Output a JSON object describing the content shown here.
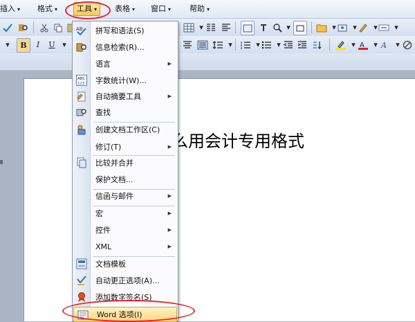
{
  "menubar": {
    "items": [
      {
        "label": "插入",
        "arrow": "▾"
      },
      {
        "label": "格式",
        "arrow": "▾"
      },
      {
        "label": "工具",
        "arrow": "▾"
      },
      {
        "label": "表格",
        "arrow": "▾"
      },
      {
        "label": "窗口",
        "arrow": "▾"
      },
      {
        "label": "帮助",
        "arrow": "▾"
      }
    ]
  },
  "toolbar": {
    "bold": "B",
    "italic": "I",
    "underline": "U"
  },
  "document": {
    "text": "么用会计专用格式"
  },
  "tools_menu": {
    "items": [
      {
        "label": "拼写和语法(S)",
        "icon": "spell-check-icon"
      },
      {
        "label": "信息检索(R)...",
        "icon": "research-icon"
      },
      {
        "label": "语言",
        "has_submenu": true
      },
      {
        "label": "字数统计(W)...",
        "icon": "word-count-icon",
        "icon_text": "ABC\n123"
      },
      {
        "label": "自动摘要工具",
        "icon": "auto-summary-icon",
        "has_submenu": true
      },
      {
        "label": "查找",
        "icon": "find-icon"
      },
      {
        "label": "创建文档工作区(C)",
        "icon": "document-workspace-icon"
      },
      {
        "label": "修订(T)",
        "has_submenu": true
      },
      {
        "label": "比较并合并",
        "icon": "compare-merge-icon"
      },
      {
        "label": "保护文档..."
      },
      {
        "label": "信函与邮件",
        "has_submenu": true
      },
      {
        "label": "宏",
        "has_submenu": true
      },
      {
        "label": "控件",
        "has_submenu": true
      },
      {
        "label": "XML",
        "has_submenu": true
      },
      {
        "label": "文档模板",
        "icon": "template-icon"
      },
      {
        "label": "自动更正选项(A)...",
        "icon": "autocorrect-icon"
      },
      {
        "label": "添加数字签名(S)",
        "icon": "digital-signature-icon"
      },
      {
        "label": "Word 选项(I)",
        "icon": "word-options-icon"
      }
    ]
  },
  "colors": {
    "highlight": "#ffd57a",
    "annotation": "#e8242a"
  }
}
